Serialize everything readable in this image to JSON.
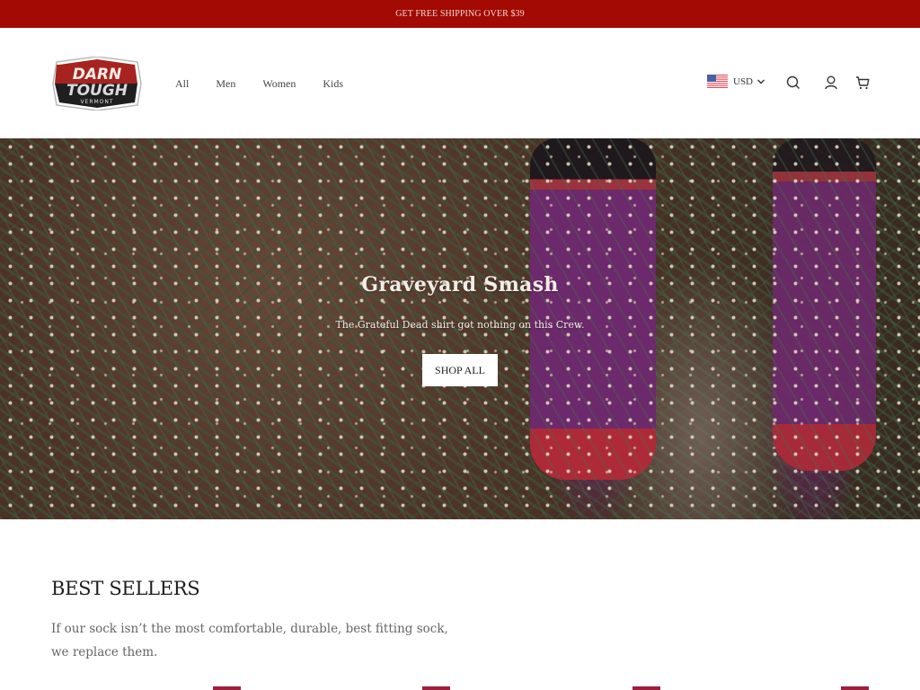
{
  "announcement": {
    "text": "GET FREE SHIPPING OVER $39"
  },
  "header": {
    "logo": {
      "line1": "DARN",
      "line2": "TOUGH",
      "line3": "VERMONT",
      "alt": "Darn Tough Vermont"
    },
    "nav": [
      {
        "label": "All"
      },
      {
        "label": "Men"
      },
      {
        "label": "Women"
      },
      {
        "label": "Kids"
      }
    ],
    "currency": {
      "label": "USD",
      "flag_icon": "us-flag-icon"
    },
    "icons": [
      "search-icon",
      "account-icon",
      "cart-icon"
    ]
  },
  "hero": {
    "title": "Graveyard Smash",
    "subtitle": "The Grateful Dead shirt got nothing on this Crew.",
    "button_label": "SHOP ALL"
  },
  "best_sellers": {
    "title": "BEST SELLERS",
    "description": "If our sock isn’t the most comfortable, durable, best fitting sock, we replace them."
  },
  "colors": {
    "announcement_bg": "#a30a04",
    "brand_red": "#a7231f",
    "badge": "#9c1f3e"
  }
}
